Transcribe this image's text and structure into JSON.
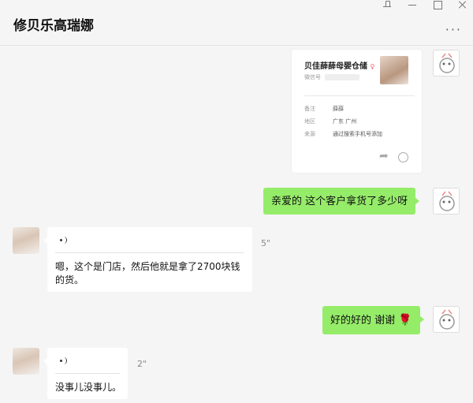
{
  "header": {
    "title": "修贝乐高瑞娜",
    "more": "···"
  },
  "card": {
    "name": "贝佳薛薛母婴仓储",
    "gender_mark": "♀",
    "wechat_label": "微信号",
    "rows": [
      {
        "label": "备注",
        "value": "薛薛"
      },
      {
        "label": "地区",
        "value": "广东 广州"
      },
      {
        "label": "来源",
        "value": "通过搜索手机号添加"
      }
    ]
  },
  "messages": {
    "m1": {
      "text": "亲爱的 这个客户拿货了多少呀"
    },
    "m2": {
      "duration": "5\"",
      "transcript": "嗯，这个是门店，然后他就是拿了2700块钱的货。"
    },
    "m3": {
      "text": "好的好的 谢谢",
      "emoji": "🌹"
    },
    "m4": {
      "duration": "2\"",
      "transcript": "没事儿没事儿。"
    }
  }
}
